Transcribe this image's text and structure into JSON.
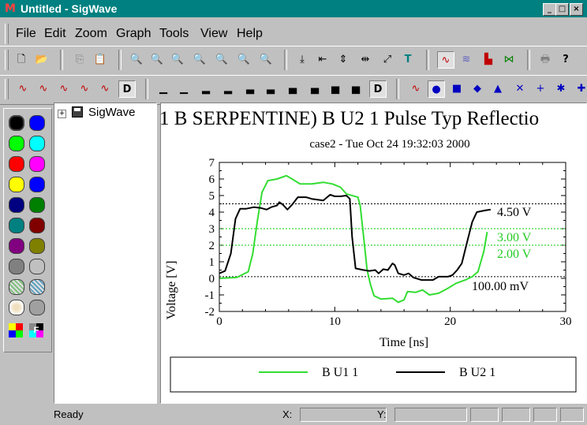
{
  "window": {
    "title": "Untitled - SigWave",
    "app_icon": "M"
  },
  "menu": [
    "File",
    "Edit",
    "Zoom",
    "Graph",
    "Tools",
    "View",
    "Help"
  ],
  "tree": {
    "root_label": "SigWave",
    "expander": "+"
  },
  "plot": {
    "banner": "1 B SERPENTINE) B U2 1 Pulse Typ Reflectio",
    "subtitle": "case2 - Tue Oct 24 19:32:03 2000",
    "xlabel": "Time [ns]",
    "ylabel": "Voltage [V]",
    "annotations": [
      "4.50 V",
      "3.00 V",
      "2.00 V",
      "100.00 mV"
    ]
  },
  "chart_data": {
    "type": "line",
    "title": "case2 - Tue Oct 24 19:32:03 2000",
    "xlabel": "Time [ns]",
    "ylabel": "Voltage [V]",
    "xlim": [
      0,
      30
    ],
    "ylim": [
      -2,
      7
    ],
    "x_ticks": [
      "0",
      "10",
      "20",
      "30"
    ],
    "y_ticks": [
      "-2",
      "-1",
      "0",
      "1",
      "2",
      "3",
      "4",
      "5",
      "6",
      "7"
    ],
    "thresholds": [
      {
        "label": "4.50 V",
        "value": 4.5,
        "color": "#000000"
      },
      {
        "label": "3.00 V",
        "value": 3.0,
        "color": "#00cc00"
      },
      {
        "label": "2.00 V",
        "value": 2.0,
        "color": "#00cc00"
      },
      {
        "label": "100.00 mV",
        "value": 0.1,
        "color": "#000000"
      }
    ],
    "series": [
      {
        "name": "B U1 1",
        "color": "#33dd33",
        "points": [
          [
            0,
            0
          ],
          [
            1.5,
            0.05
          ],
          [
            2.5,
            0.4
          ],
          [
            2.9,
            1.5
          ],
          [
            3.3,
            3.5
          ],
          [
            3.7,
            5.2
          ],
          [
            4.2,
            5.9
          ],
          [
            5,
            6.0
          ],
          [
            5.8,
            6.2
          ],
          [
            6.3,
            6.0
          ],
          [
            7,
            5.7
          ],
          [
            8,
            5.7
          ],
          [
            9,
            5.8
          ],
          [
            9.8,
            5.7
          ],
          [
            10.5,
            5.5
          ],
          [
            11,
            5.1
          ],
          [
            12,
            4.9
          ],
          [
            12.2,
            4.4
          ],
          [
            12.5,
            2.5
          ],
          [
            12.8,
            0.5
          ],
          [
            13.1,
            -0.4
          ],
          [
            13.4,
            -1.05
          ],
          [
            14,
            -1.25
          ],
          [
            15,
            -1.2
          ],
          [
            15.5,
            -1.45
          ],
          [
            16,
            -1.3
          ],
          [
            16.3,
            -0.8
          ],
          [
            17,
            -0.85
          ],
          [
            17.6,
            -0.7
          ],
          [
            18.2,
            -1.0
          ],
          [
            19,
            -0.9
          ],
          [
            19.8,
            -0.6
          ],
          [
            20.5,
            -0.3
          ],
          [
            21.3,
            -0.1
          ],
          [
            21.9,
            0.1
          ],
          [
            22.4,
            0.4
          ],
          [
            22.9,
            1.6
          ],
          [
            23.2,
            2.8
          ]
        ]
      },
      {
        "name": "B U2 1",
        "color": "#000000",
        "points": [
          [
            0,
            0.3
          ],
          [
            0.5,
            0.45
          ],
          [
            1,
            1.5
          ],
          [
            1.4,
            3.6
          ],
          [
            1.8,
            4.2
          ],
          [
            2.3,
            4.2
          ],
          [
            3,
            4.3
          ],
          [
            3.6,
            4.25
          ],
          [
            4.1,
            4.15
          ],
          [
            4.5,
            4.3
          ],
          [
            5,
            4.4
          ],
          [
            5.2,
            4.6
          ],
          [
            5.5,
            4.45
          ],
          [
            5.9,
            4.15
          ],
          [
            6.3,
            4.45
          ],
          [
            6.8,
            4.9
          ],
          [
            7.5,
            4.9
          ],
          [
            8,
            4.8
          ],
          [
            9,
            4.7
          ],
          [
            9.6,
            5.05
          ],
          [
            10,
            4.95
          ],
          [
            10.5,
            4.95
          ],
          [
            11,
            5.0
          ],
          [
            11.3,
            4.8
          ],
          [
            11.5,
            2.5
          ],
          [
            11.8,
            0.6
          ],
          [
            12.5,
            0.5
          ],
          [
            13,
            0.45
          ],
          [
            13.5,
            0.5
          ],
          [
            13.8,
            0.3
          ],
          [
            14.2,
            0.55
          ],
          [
            14.6,
            0.5
          ],
          [
            15,
            0.9
          ],
          [
            15.2,
            0.8
          ],
          [
            15.5,
            0.3
          ],
          [
            16,
            0.2
          ],
          [
            16.4,
            0.3
          ],
          [
            16.8,
            0.05
          ],
          [
            17.5,
            -0.1
          ],
          [
            18.5,
            -0.1
          ],
          [
            19,
            0.1
          ],
          [
            19.8,
            0.1
          ],
          [
            20.2,
            0.2
          ],
          [
            20.6,
            0.5
          ],
          [
            21,
            0.9
          ],
          [
            21.5,
            2.3
          ],
          [
            21.9,
            3.4
          ],
          [
            22.3,
            4.0
          ],
          [
            23,
            4.1
          ],
          [
            23.5,
            4.15
          ]
        ]
      }
    ],
    "legend": {
      "placement": "bottom",
      "entries": [
        "B U1 1",
        "B U2 1"
      ]
    }
  },
  "status": {
    "text": "Ready",
    "x_label": "X:",
    "y_label": "Y:"
  }
}
